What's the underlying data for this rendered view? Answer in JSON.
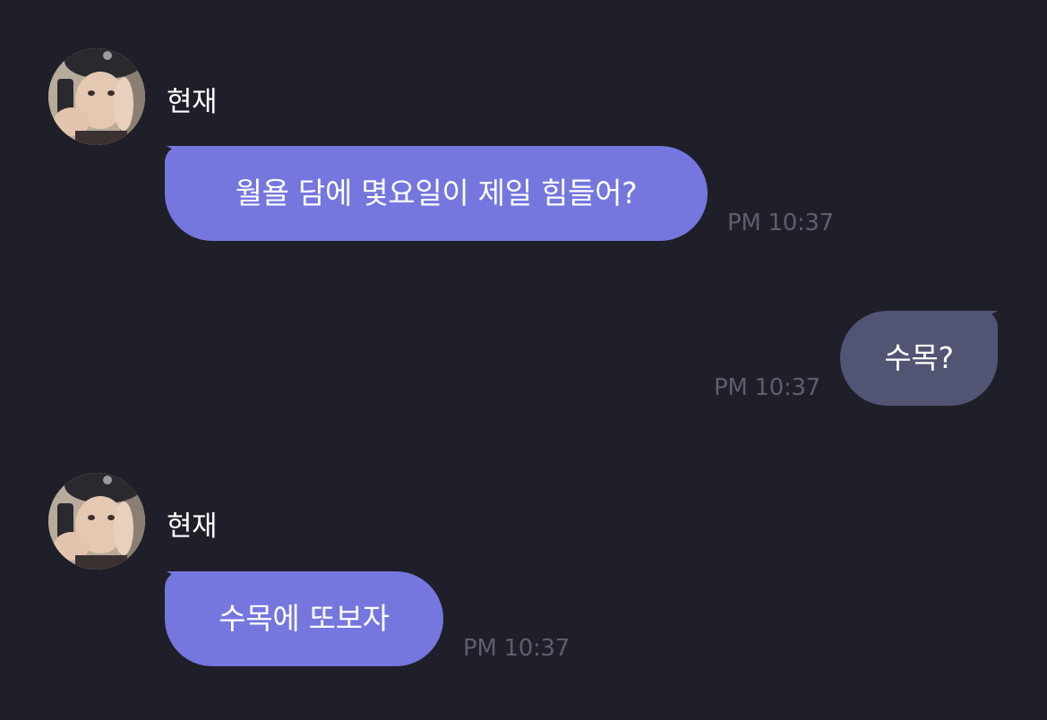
{
  "colors": {
    "background": "#1f1f29",
    "incoming_bubble": "#7577de",
    "outgoing_bubble": "#525473",
    "timestamp": "#5e5e6c",
    "name": "#ffffff"
  },
  "messages": [
    {
      "direction": "incoming",
      "sender": "현재",
      "avatar_icon": "profile-photo-icon",
      "text": "월욜 담에 몇요일이 제일 힘들어?",
      "time": "PM 10:37"
    },
    {
      "direction": "outgoing",
      "text": "수목?",
      "time": "PM 10:37"
    },
    {
      "direction": "incoming",
      "sender": "현재",
      "avatar_icon": "profile-photo-icon",
      "text": "수목에 또보자",
      "time": "PM 10:37"
    }
  ]
}
